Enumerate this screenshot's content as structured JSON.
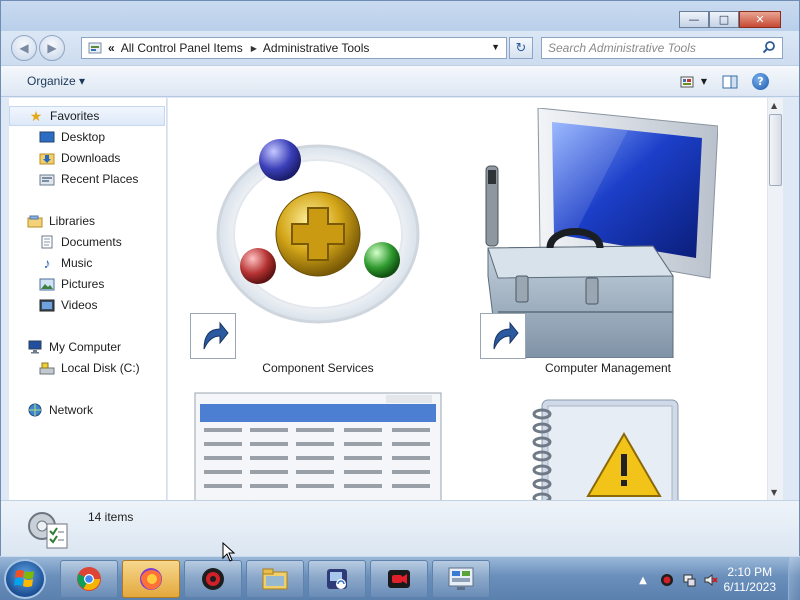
{
  "window": {
    "minimize_glyph": "—",
    "maximize_glyph": "□",
    "close_glyph": "✕"
  },
  "nav": {
    "back_glyph": "◀",
    "forward_glyph": "▶"
  },
  "address": {
    "overflow": "«",
    "crumbs": [
      "All Control Panel Items",
      "Administrative Tools"
    ],
    "refresh_glyph": "↻"
  },
  "search": {
    "placeholder": "Search Administrative Tools",
    "icon": "search-icon"
  },
  "toolbar": {
    "organize_label": "Organize ▾",
    "help_label": "?"
  },
  "sidebar": {
    "favorites": "Favorites",
    "desktop": "Desktop",
    "downloads": "Downloads",
    "recent": "Recent Places",
    "libraries": "Libraries",
    "documents": "Documents",
    "music": "Music",
    "pictures": "Pictures",
    "videos": "Videos",
    "computer": "My Computer",
    "local_disk": "Local Disk (C:)",
    "network": "Network"
  },
  "tiles": {
    "component_services": "Component Services",
    "computer_management": "Computer Management"
  },
  "status": {
    "count": "14 items"
  },
  "clock": {
    "time": "2:10 PM",
    "date": "6/11/2023"
  },
  "colors": {
    "accent": "#2b5797",
    "taskbar": "#6a8fbb",
    "window_frame": "#dfe9f5"
  }
}
